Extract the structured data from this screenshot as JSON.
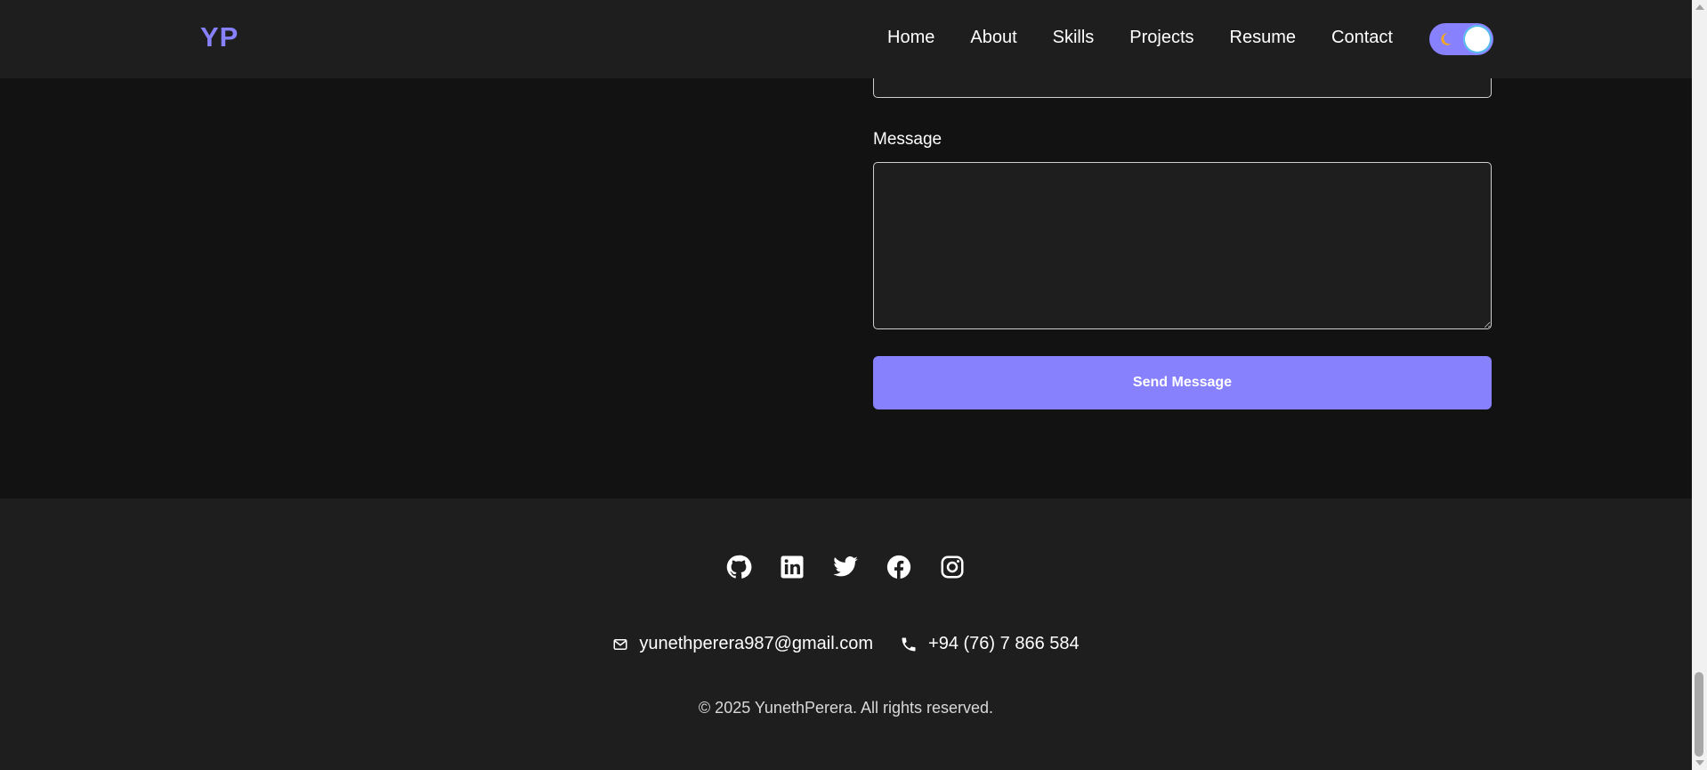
{
  "header": {
    "logo": "YP",
    "nav": [
      {
        "label": "Home"
      },
      {
        "label": "About"
      },
      {
        "label": "Skills"
      },
      {
        "label": "Projects"
      },
      {
        "label": "Resume"
      },
      {
        "label": "Contact"
      }
    ],
    "theme_toggle": {
      "state": "dark",
      "icon": "moon-icon"
    }
  },
  "contact_form": {
    "message_label": "Message",
    "message_value": "",
    "submit_label": "Send Message"
  },
  "footer": {
    "social": [
      {
        "icon": "github-icon"
      },
      {
        "icon": "linkedin-icon"
      },
      {
        "icon": "twitter-icon"
      },
      {
        "icon": "facebook-icon"
      },
      {
        "icon": "instagram-icon"
      }
    ],
    "email": "yunethperera987@gmail.com",
    "phone": "+94 (76) 7 866 584",
    "copyright": "© 2025 YunethPerera. All rights reserved."
  },
  "colors": {
    "accent": "#8881fd",
    "header_bg": "#1e1e1e",
    "page_bg": "#121212",
    "footer_bg": "#1e1e1e"
  }
}
